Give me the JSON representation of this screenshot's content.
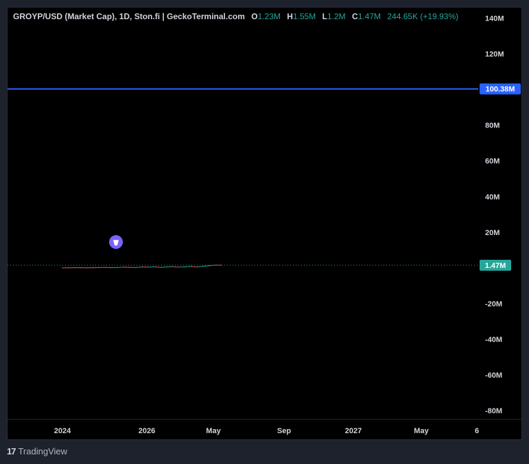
{
  "legend": {
    "symbol": "GROYP/USD (Market Cap), 1D, Ston.fi | GeckoTerminal.com",
    "open_key": "O",
    "open": "1.23M",
    "high_key": "H",
    "high": "1.55M",
    "low_key": "L",
    "low": "1.2M",
    "close_key": "C",
    "close": "1.47M",
    "change": "244.65K (+19.93%)"
  },
  "footer": {
    "brand": "TradingView",
    "logo": "17"
  },
  "colors": {
    "up": "#26a69a",
    "down": "#ef5350",
    "hline": "#2962ff",
    "background": "#000000",
    "frame": "#1e222d"
  },
  "chart_data": {
    "type": "line",
    "title": "GROYP/USD (Market Cap), 1D, Ston.fi | GeckoTerminal.com",
    "xlabel": "",
    "ylabel": "",
    "y_ticks": [
      "140M",
      "120M",
      "80M",
      "60M",
      "40M",
      "20M",
      "-20M",
      "-40M",
      "-60M",
      "-80M"
    ],
    "y_tick_values": [
      140,
      120,
      80,
      60,
      40,
      20,
      -20,
      -40,
      -60,
      -80
    ],
    "ylim": [
      -85,
      146
    ],
    "x_ticks": [
      "2024",
      "2026",
      "May",
      "Sep",
      "2027",
      "May",
      "6"
    ],
    "horizontal_line": {
      "value": 100.38,
      "label": "100.38M"
    },
    "last_price": {
      "value": 1.47,
      "label": "1.47M"
    },
    "series": [
      {
        "values": [
          0,
          0.05,
          0.1,
          0.1,
          0.05,
          0.1,
          0.2,
          0.3,
          0.1,
          0.2,
          0.4,
          0.3,
          0.2,
          0.5,
          0.4,
          0.6,
          0.3,
          0.5,
          0.7,
          0.4,
          0.6,
          0.8,
          0.5,
          0.9,
          1.23,
          1.55,
          1.47
        ]
      }
    ],
    "grid": false,
    "marker_icon": "tonfish-icon"
  }
}
